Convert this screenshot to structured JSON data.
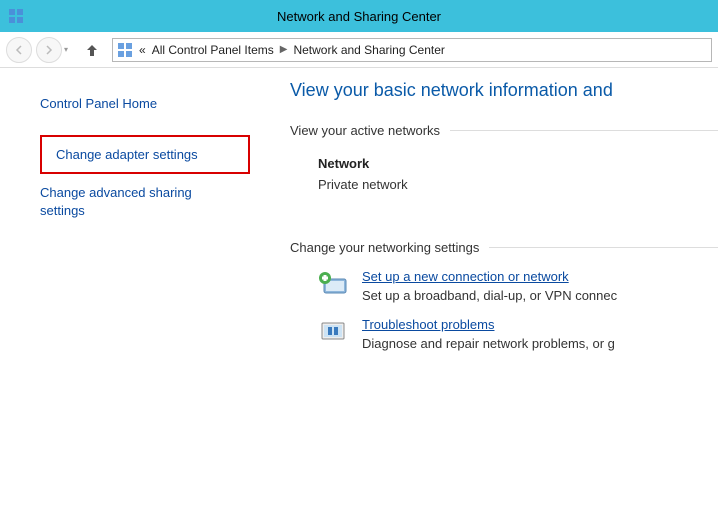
{
  "window": {
    "title": "Network and Sharing Center"
  },
  "breadcrumb": {
    "prefix": "«",
    "part1": "All Control Panel Items",
    "part2": "Network and Sharing Center"
  },
  "sidebar": {
    "home": "Control Panel Home",
    "change_adapter": "Change adapter settings",
    "change_advanced": "Change advanced sharing settings"
  },
  "main": {
    "title": "View your basic network information and",
    "active_head": "View your active networks",
    "network": {
      "name": "Network",
      "type": "Private network"
    },
    "change_head": "Change your networking settings",
    "actions": [
      {
        "link": "Set up a new connection or network",
        "desc": "Set up a broadband, dial-up, or VPN connec"
      },
      {
        "link": "Troubleshoot problems",
        "desc": "Diagnose and repair network problems, or g"
      }
    ]
  }
}
